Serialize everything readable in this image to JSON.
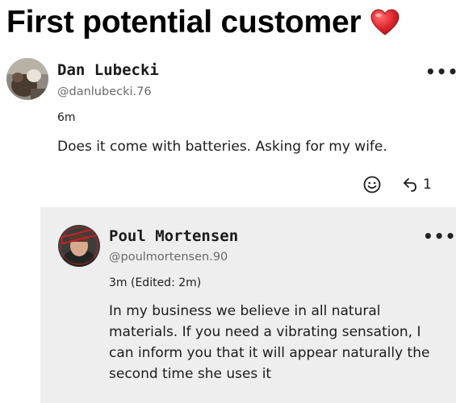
{
  "headline": {
    "text": "First potential customer",
    "emoji": "heart-icon"
  },
  "comment": {
    "author": "Dan Lubecki",
    "handle": "@danlubecki.76",
    "time": "6m",
    "text": "Does it come with batteries. Asking for my wife.",
    "more_label": "•••",
    "reply_count": "1"
  },
  "reply": {
    "author": "Poul Mortensen",
    "handle": "@poulmortensen.90",
    "time": "3m (Edited: 2m)",
    "lines": [
      "In my business we believe in all natural",
      "materials. If you need a vibrating sensation, I",
      "can inform you that it will appear naturally the",
      "second time she uses it"
    ],
    "more_label": "•••"
  },
  "colors": {
    "reply_background": "#eeeeee",
    "heart": "#d8232a"
  }
}
